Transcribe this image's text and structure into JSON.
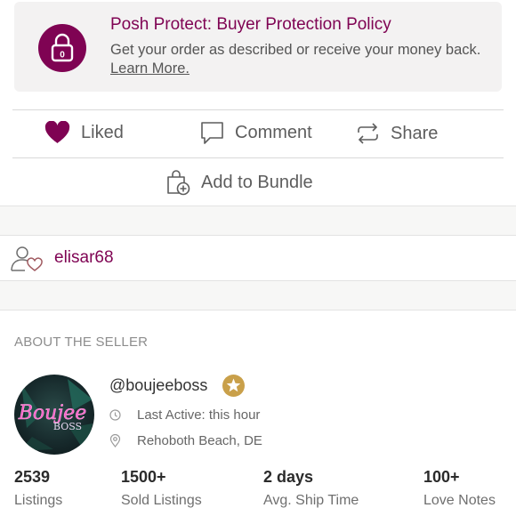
{
  "protect": {
    "title": "Posh Protect: Buyer Protection Policy",
    "text": "Get your order as described or receive your money back.",
    "link": "Learn More.",
    "icon": "lock-icon"
  },
  "actions": {
    "like_label": "Liked",
    "comment_label": "Comment",
    "share_label": "Share",
    "bundle_label": "Add to Bundle"
  },
  "liker": {
    "username": "elisar68",
    "icon": "user-heart-icon"
  },
  "seller": {
    "heading": "ABOUT THE SELLER",
    "handle": "@boujeeboss",
    "last_active": "Last Active: this hour",
    "location": "Rehoboth Beach, DE",
    "avatar_text": "Boujee",
    "avatar_text_2": "BOSS",
    "stats": [
      {
        "value": "2539",
        "label": "Listings"
      },
      {
        "value": "1500+",
        "label": "Sold Listings"
      },
      {
        "value": "2 days",
        "label": "Avg. Ship Time"
      },
      {
        "value": "100+",
        "label": "Love Notes"
      }
    ]
  },
  "colors": {
    "brand": "#7f0353",
    "star_gold": "#c9a04a"
  }
}
